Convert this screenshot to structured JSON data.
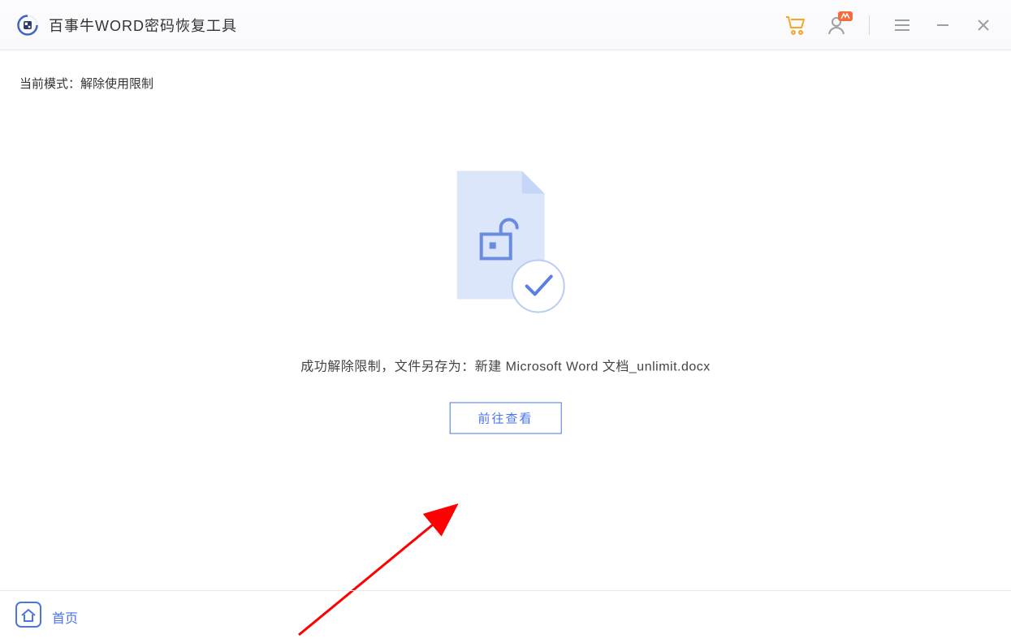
{
  "header": {
    "app_title": "百事牛WORD密码恢复工具"
  },
  "main": {
    "mode_label": "当前模式：",
    "mode_value": "解除使用限制",
    "success_prefix": "成功解除限制，文件另存为：",
    "saved_filename": "新建 Microsoft Word 文档_unlimit.docx",
    "view_button_label": "前往查看"
  },
  "footer": {
    "home_label": "首页"
  },
  "icons": {
    "cart": "cart-icon",
    "user": "user-icon",
    "menu": "menu-icon",
    "minimize": "minimize-icon",
    "close": "close-icon",
    "home": "home-icon",
    "logo": "app-logo-icon",
    "document_unlock": "document-unlock-icon",
    "checkmark": "checkmark-icon"
  },
  "colors": {
    "accent": "#4a74e8",
    "cart": "#f6a623",
    "badge": "#f56a3a",
    "arrow": "#ff0000"
  }
}
